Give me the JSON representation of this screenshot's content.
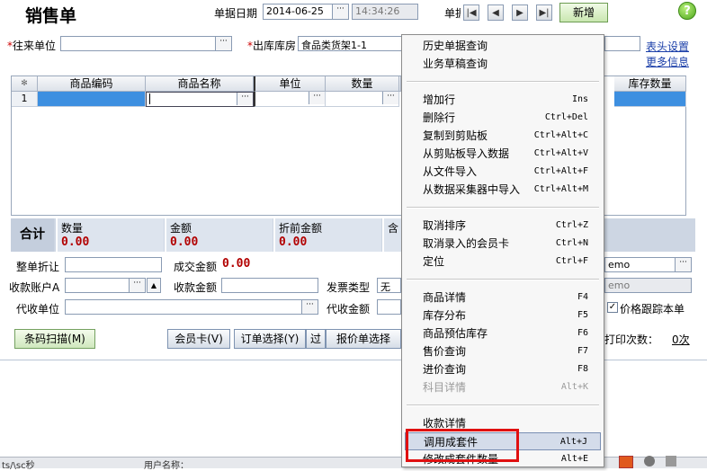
{
  "header": {
    "title": "销售单",
    "date_label": "单据日期",
    "date_value": "2014-06-25",
    "time_value": "14:34:26",
    "number_label": "单据",
    "new_button": "新增",
    "help_icon": "help-icon"
  },
  "form": {
    "partner_label": "往来单位",
    "warehouse_label": "出库库房",
    "warehouse_value": "食品类货架1-1",
    "header_settings_link": "表头设置",
    "more_info_link": "更多信息"
  },
  "grid": {
    "columns": [
      "商品编码",
      "商品名称",
      "单位",
      "数量",
      "库存数量"
    ],
    "corner_mark": "✻",
    "rows": [
      {
        "index": "1"
      }
    ]
  },
  "totals": {
    "label": "合计",
    "cells": [
      {
        "label": "数量",
        "value": "0.00"
      },
      {
        "label": "金额",
        "value": "0.00"
      },
      {
        "label": "折前金额",
        "value": "0.00"
      },
      {
        "label": "含",
        "value": ""
      }
    ]
  },
  "lower_form": {
    "discount_label": "整单折让",
    "deal_amount_label": "成交金额",
    "deal_amount_value": "0.00",
    "account_label": "收款账户A",
    "receive_amount_label": "收款金额",
    "invoice_type_label": "发票类型",
    "invoice_type_value": "无",
    "collect_unit_label": "代收单位",
    "collect_amount_label": "代收金额",
    "memo_value_1": "emo",
    "memo_value_2": "emo",
    "price_track_label": "价格跟踪本单",
    "print_count_label": "打印次数：",
    "print_count_value": "0次"
  },
  "buttons": {
    "barcode_scan": "条码扫描(M)",
    "member_card": "会员卡(V)",
    "order_select": "订单选择(Y)",
    "partial_hidden": "过",
    "quote_select": "报价单选择"
  },
  "status_bar": {
    "left_text": "ts/\\sc秒",
    "user_label": "用户名称："
  },
  "context_menu": {
    "groups": [
      [
        {
          "label": "历史单据查询",
          "shortcut": ""
        },
        {
          "label": "业务草稿查询",
          "shortcut": ""
        }
      ],
      [
        {
          "label": "增加行",
          "shortcut": "Ins"
        },
        {
          "label": "删除行",
          "shortcut": "Ctrl+Del"
        },
        {
          "label": "复制到剪贴板",
          "shortcut": "Ctrl+Alt+C"
        },
        {
          "label": "从剪贴板导入数据",
          "shortcut": "Ctrl+Alt+V"
        },
        {
          "label": "从文件导入",
          "shortcut": "Ctrl+Alt+F"
        },
        {
          "label": "从数据采集器中导入",
          "shortcut": "Ctrl+Alt+M"
        }
      ],
      [
        {
          "label": "取消排序",
          "shortcut": "Ctrl+Z"
        },
        {
          "label": "取消录入的会员卡",
          "shortcut": "Ctrl+N"
        },
        {
          "label": "定位",
          "shortcut": "Ctrl+F"
        }
      ],
      [
        {
          "label": "商品详情",
          "shortcut": "F4"
        },
        {
          "label": "库存分布",
          "shortcut": "F5"
        },
        {
          "label": "商品预估库存",
          "shortcut": "F6"
        },
        {
          "label": "售价查询",
          "shortcut": "F7"
        },
        {
          "label": "进价查询",
          "shortcut": "F8"
        },
        {
          "label": "科目详情",
          "shortcut": "Alt+K",
          "disabled": true
        }
      ],
      [
        {
          "label": "收款详情",
          "shortcut": ""
        },
        {
          "label": "调用成套件",
          "shortcut": "Alt+J",
          "highlighted": true
        },
        {
          "label": "修改成套件数量",
          "shortcut": "Alt+E"
        }
      ]
    ]
  },
  "colors": {
    "selected_row": "#3d8fe0",
    "total_value": "#b20000",
    "highlight_box": "#e01010"
  }
}
